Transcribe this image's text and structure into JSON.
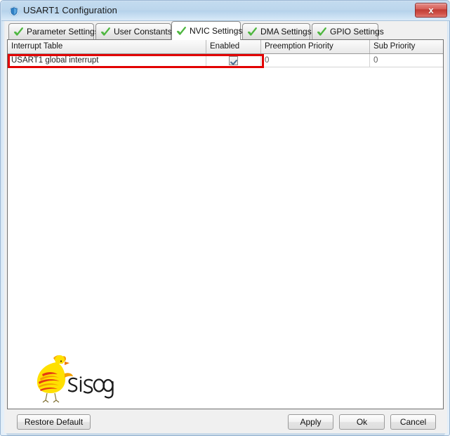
{
  "window": {
    "title": "USART1 Configuration",
    "icon": "app-shield-icon",
    "close_label": "x",
    "titlebar_color": "#bcd6ec",
    "close_color": "#c03c34"
  },
  "tabs": [
    {
      "label": "Parameter Settings",
      "icon": "green-check-icon",
      "selected": false
    },
    {
      "label": "User Constants",
      "icon": "green-check-icon",
      "selected": false
    },
    {
      "label": "NVIC Settings",
      "icon": "green-check-icon",
      "selected": true
    },
    {
      "label": "DMA Settings",
      "icon": "green-check-icon",
      "selected": false
    },
    {
      "label": "GPIO Settings",
      "icon": "green-check-icon",
      "selected": false
    }
  ],
  "table": {
    "columns": [
      "Interrupt Table",
      "Enabled",
      "Preemption Priority",
      "Sub Priority"
    ],
    "rows": [
      {
        "interrupt_table": "USART1 global interrupt",
        "enabled": true,
        "preemption_priority": "0",
        "sub_priority": "0"
      }
    ]
  },
  "annotation": {
    "highlight_color": "#e20000",
    "target": "first-interrupt-row"
  },
  "logo": {
    "text": "Sisoog",
    "bird_body_color": "#ffe000",
    "bird_stripe_color": "#e53b12",
    "bird_accent_color": "#f5a000"
  },
  "buttons": {
    "restore_default": "Restore Default",
    "apply": "Apply",
    "ok": "Ok",
    "cancel": "Cancel"
  }
}
